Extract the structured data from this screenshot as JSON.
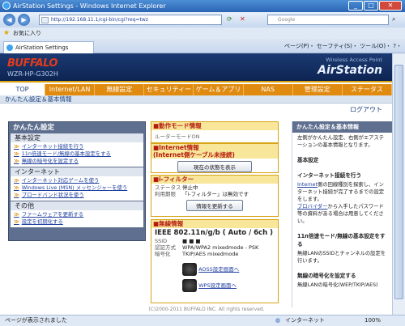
{
  "window": {
    "title": "AirStation Settings - Windows Internet Explorer"
  },
  "address": {
    "url": "http://192.168.11.1/cgi-bin/cgi?req=twz",
    "search_placeholder": "Google"
  },
  "favorites": {
    "label": "お気に入り"
  },
  "tab": {
    "label": "AirStation Settings"
  },
  "toolbar": {
    "items": "ページ(P)・ セーフティ(S)・ ツール(O)・ ?・"
  },
  "header": {
    "logo": "BUFFALO",
    "model": "WZR-HP-G302H",
    "wap": "Wireless Access Point",
    "brand": "AirStation"
  },
  "nav": [
    "TOP",
    "Internet/LAN",
    "無線設定",
    "セキュリティー",
    "ゲーム＆アプリ",
    "NAS",
    "管理設定",
    "ステータス"
  ],
  "breadcrumb": "かんたん設定＆基本情報",
  "logout": "ログアウト",
  "leftmenu": {
    "title": "かんたん設定",
    "sections": [
      {
        "name": "基本設定",
        "links": [
          "インターネット接続を行う",
          "11n倍速モード/無線の基本設定をする",
          "無線の暗号化を設定する"
        ]
      },
      {
        "name": "インターネット",
        "links": [
          "インターネット対応ゲームを使う",
          "Windows Live (MSN) メッセンジャーを使う",
          "ブロードバンド状況を使う"
        ]
      },
      {
        "name": "その他",
        "links": [
          "ファームウェアを更新する",
          "設定を初期化する"
        ]
      }
    ]
  },
  "panels": {
    "mode": {
      "title": "■動作モード情報",
      "value": "ルーターモードON"
    },
    "internet": {
      "title": "■Internet情報",
      "subtitle": "(Internet側ケーブル未接続)",
      "button": "現在の状態を表示"
    },
    "ifilter": {
      "title": "■i-フィルター",
      "rows": [
        [
          "ステータス",
          "停止中"
        ],
        [
          "利用期限",
          "「i-フィルター」は無効です"
        ]
      ],
      "button": "情報を更新する"
    },
    "wireless": {
      "title": "■無線情報",
      "standard": "IEEE 802.11n/g/b ( Auto / 6ch )",
      "rows": [
        [
          "SSID",
          "■ ■ ■"
        ],
        [
          "認証方式",
          "WPA/WPA2 mixedmode - PSK"
        ],
        [
          "暗号化",
          "TKIP/AES mixedmode"
        ]
      ],
      "aoss": "AOSS設定画面へ",
      "wps": "WPS設定画面へ"
    }
  },
  "help": {
    "title": "かんたん設定＆基本情報",
    "intro": "左側がかんたん設定、右側がエアステーションの基本情報となります。",
    "section": "基本設定",
    "items": [
      {
        "head": "インターネット接続を行う",
        "body_link": "Internet",
        "body": "側の回線種別を探索し、インターネット接続が完了するまでの設定をします。",
        "body2_link": "プロバイダー",
        "body2": "から入手したパスワード等の資料がある場合は用意してください。"
      },
      {
        "head": "11n倍速モード/無線の基本設定をする",
        "body": "無線LANのSSIDとチャンネルの設定を行います。"
      },
      {
        "head": "無線の暗号化を設定する",
        "body": "無線LANの暗号化(WEP/TKIP/AES)"
      }
    ]
  },
  "footer": "(C)2000-2011 BUFFALO INC. All rights reserved.",
  "status": {
    "left": "ページが表示されました",
    "zone": "インターネット",
    "zoom": "100%"
  }
}
